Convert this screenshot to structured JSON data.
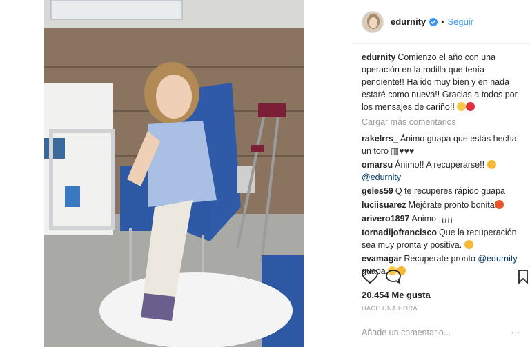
{
  "header": {
    "username": "edurnity",
    "dot": "•",
    "follow": "Seguir"
  },
  "caption": {
    "user": "edurnity",
    "text": "Comienzo el año con una operación en la rodilla que tenía pendiente!! Ha ido muy bien y en nada estaré como nueva!! Gracias a todos por los mensajes de cariño!!"
  },
  "load_more": "Cargar más comentarios",
  "comments": [
    {
      "user": "rakelrrs_",
      "text": "Ánimo guapa que estás hecha un toro"
    },
    {
      "user": "omarsu",
      "text": "Ánimo!! A recuperarse!!",
      "mention": "@edurnity"
    },
    {
      "user": "geles59",
      "text": "Q te recuperes rápido guapa"
    },
    {
      "user": "luciisuarez",
      "text": "Mejórate pronto bonita"
    },
    {
      "user": "arivero1897",
      "text": "Animo ¡¡¡¡¡"
    },
    {
      "user": "tornadijofrancisco",
      "text": "Que la recuperación sea muy pronta y positiva."
    },
    {
      "user": "evamagar",
      "text": "Recuperate pronto",
      "mention": "@edurnity",
      "tail": "guapa"
    }
  ],
  "likes": "20.454 Me gusta",
  "timestamp": "HACE UNA HORA",
  "add_comment_placeholder": "Añade un comentario...",
  "colors": {
    "link": "#3897f0",
    "mention": "#003569",
    "muted": "#999999"
  },
  "icons": [
    "heart-icon",
    "comment-icon",
    "bookmark-icon",
    "verified-badge-icon",
    "more-icon"
  ]
}
